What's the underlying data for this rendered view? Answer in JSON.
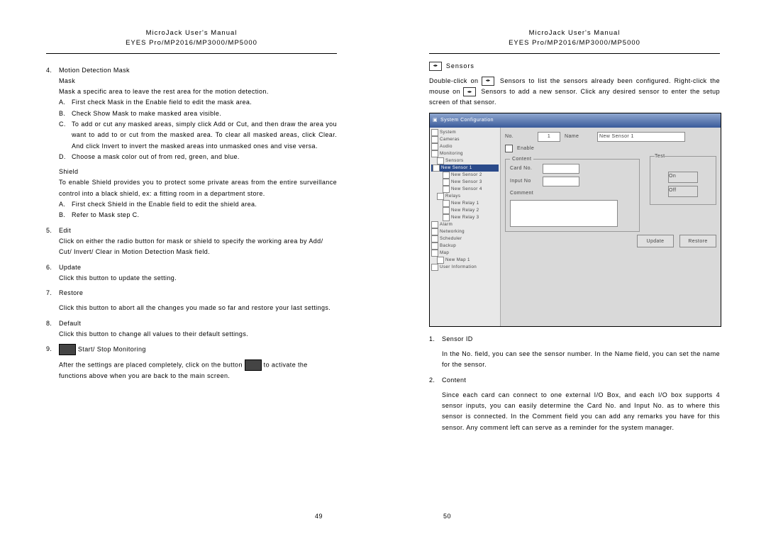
{
  "header": {
    "line1": "MicroJack User's Manual",
    "line2": "EYES Pro/MP2016/MP3000/MP5000"
  },
  "left": {
    "s4": {
      "title": "Motion Detection Mask",
      "mask_h": "Mask",
      "mask_p": "Mask a specific area to leave the rest area for the motion detection.",
      "a": "First check Mask in the Enable field to edit the mask area.",
      "b": "Check Show Mask to make masked area visible.",
      "c": "To add or cut any masked areas, simply click Add or Cut, and then draw the area you want to add to or cut from the masked area.  To clear all masked areas, click Clear. And click Invert to invert the masked areas into unmasked ones and vise versa.",
      "d": "Choose a mask color out of from red, green, and blue.",
      "shield_h": "Shield",
      "shield_p": "To enable Shield provides you to protect some private areas from the entire surveillance control into a black shield, ex: a fitting room in a department store.",
      "sa": "First check Shield in the Enable field to edit the shield area.",
      "sb": "Refer to Mask step C."
    },
    "s5": {
      "title": "Edit",
      "body": "Click on either the radio button for mask or shield to specify the working area by Add/ Cut/ Invert/ Clear in Motion Detection Mask field."
    },
    "s6": {
      "title": "Update",
      "body": "Click this button to update the setting."
    },
    "s7": {
      "title": "Restore",
      "body": "Click this button to abort all the changes you made so far and restore your last settings."
    },
    "s8": {
      "title": "Default",
      "body": "Click this button to change all values to their default settings."
    },
    "s9": {
      "title": "Start/ Stop Monitoring",
      "body1": "After the settings are placed completely, click on the button ",
      "body2": " to activate the functions above when you are back to the main screen."
    },
    "pagenum": "49"
  },
  "right": {
    "sensors_h": "Sensors",
    "p1a": "Double-click on ",
    "p1b": " Sensors to list the sensors already been configured. Right-click the mouse on ",
    "p1c": " Sensors to add a new sensor.  Click any desired sensor to enter the setup screen of that sensor.",
    "fig": {
      "title": "System Configuration",
      "tree": [
        "System",
        "Cameras",
        "Audio",
        "Monitoring",
        "Sensors",
        "New Sensor 1",
        "New Sensor 2",
        "New Sensor 3",
        "New Sensor 4",
        "Relays",
        "New Relay 1",
        "New Relay 2",
        "New Relay 3",
        "Alarm",
        "Networking",
        "Scheduler",
        "Backup",
        "Map",
        "New Map 1",
        "User Information"
      ],
      "form": {
        "no_lbl": "No.",
        "no_val": "1",
        "name_lbl": "Name",
        "name_val": "New Sensor 1",
        "enable": "Enable",
        "content": "Content",
        "test": "Test",
        "card": "Card No.",
        "input": "Input No",
        "comment": "Comment",
        "btn_on": "On",
        "btn_off": "Off",
        "update": "Update",
        "restore": "Restore"
      }
    },
    "s1": {
      "title": "Sensor ID",
      "body": "In the No. field, you can see the sensor number.  In the Name field, you can set the name for the sensor."
    },
    "s2": {
      "title": "Content",
      "body": "Since each card can connect to one external I/O Box, and each I/O box supports 4 sensor inputs, you can easily determine the Card No. and Input No. as to where this sensor is connected.  In the Comment field you can add any remarks you have for this sensor. Any comment left can serve as a reminder for the system manager."
    },
    "pagenum": "50"
  }
}
